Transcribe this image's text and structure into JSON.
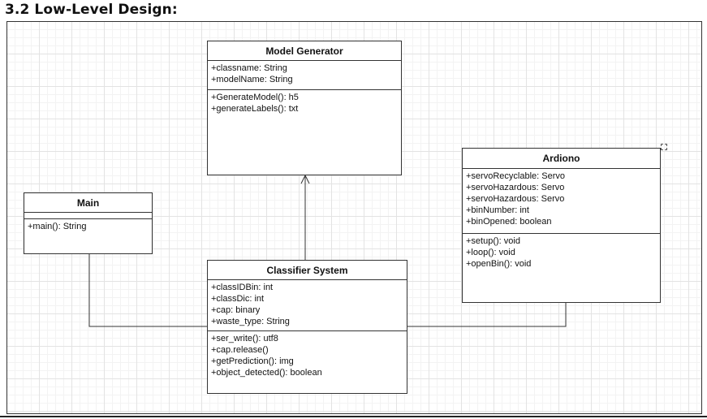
{
  "heading": "3.2 Low-Level Design:",
  "classes": {
    "model_generator": {
      "name": "Model Generator",
      "attributes": [
        "+classname: String",
        "+modelName: String"
      ],
      "methods": [
        "+GenerateModel(): h5",
        "+generateLabels(): txt"
      ]
    },
    "main": {
      "name": "Main",
      "attributes": [],
      "methods": [
        "+main(): String"
      ]
    },
    "classifier_system": {
      "name": "Classifier System",
      "attributes": [
        "+classIDBin: int",
        "+classDic: int",
        "+cap: binary",
        "+waste_type: String"
      ],
      "methods": [
        "+ser_write(): utf8",
        "+cap.release()",
        "+getPrediction(): img",
        "+object_detected(): boolean"
      ]
    },
    "ardiono": {
      "name": "Ardiono",
      "attributes": [
        "+servoRecyclable: Servo",
        "+servoHazardous: Servo",
        "+servoHazardous: Servo",
        "+binNumber: int",
        "+binOpened: boolean"
      ],
      "methods": [
        "+setup(): void",
        "+loop(): void",
        "+openBin(): void"
      ]
    }
  }
}
